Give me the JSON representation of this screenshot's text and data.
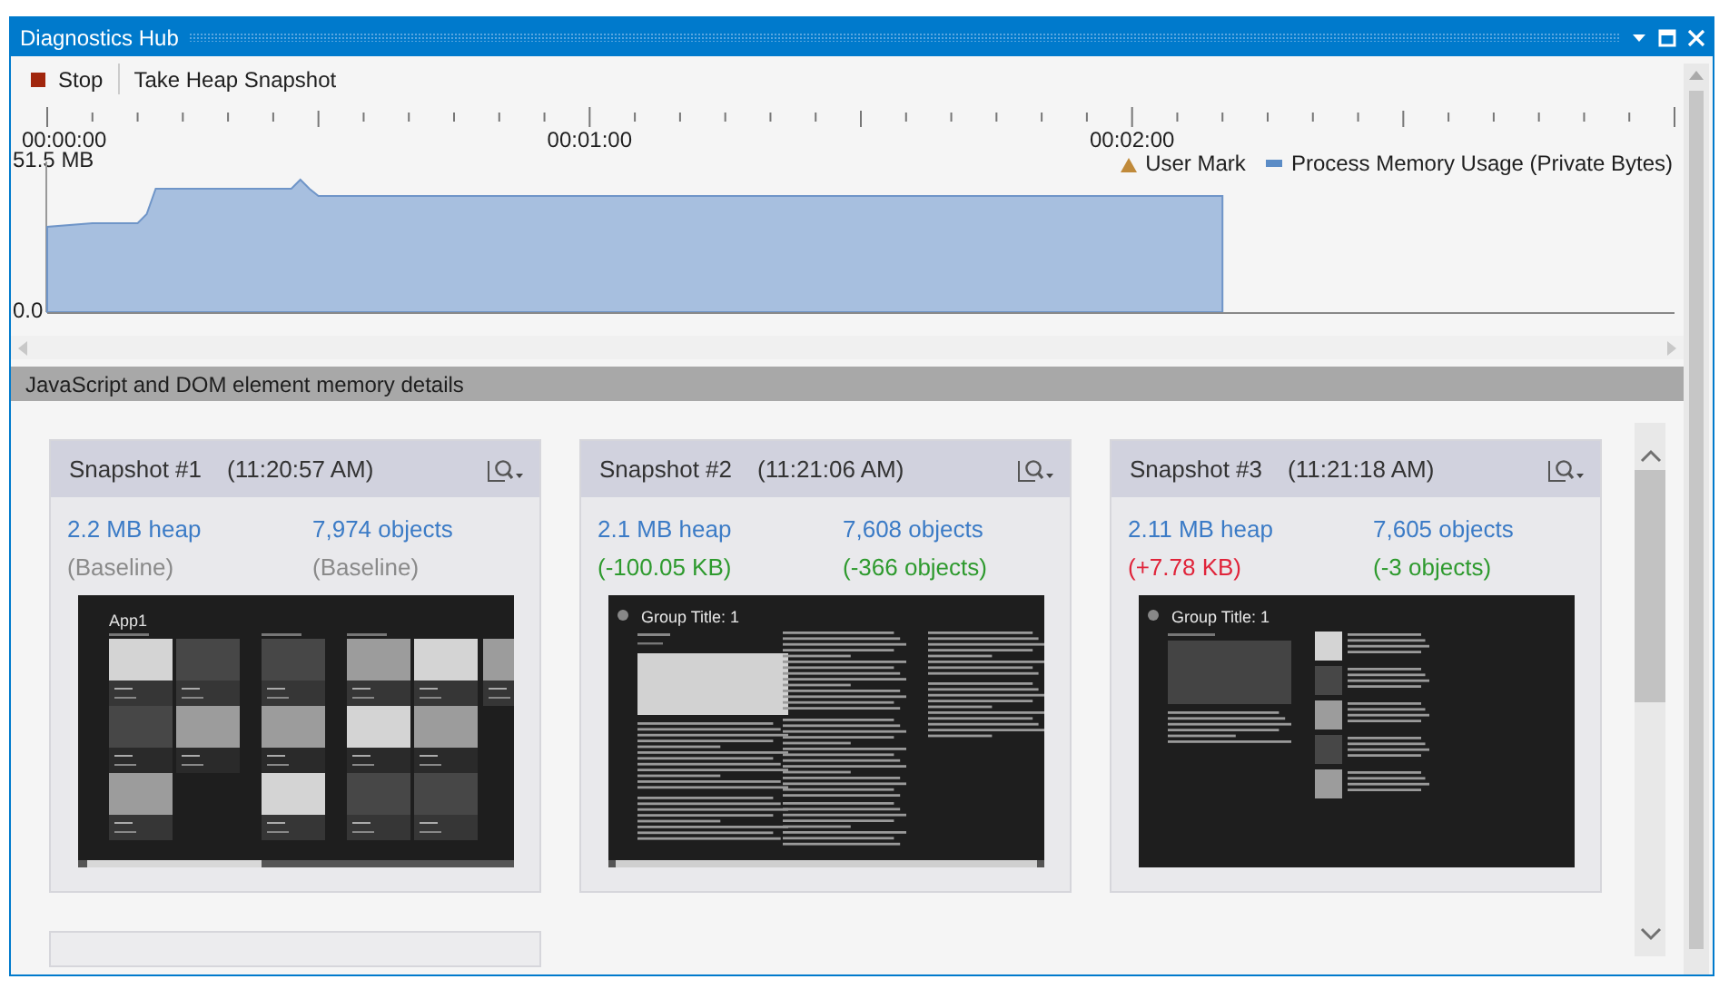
{
  "window": {
    "title": "Diagnostics Hub"
  },
  "toolbar": [
    {
      "label": "Stop",
      "kind": "stop"
    },
    {
      "label": "Take Heap Snapshot",
      "kind": "plain"
    }
  ],
  "timeline": {
    "user_mark_legend": "User Mark",
    "chart_data": {
      "type": "area",
      "x": [
        0,
        5,
        10,
        11,
        12,
        27,
        28,
        29,
        30,
        60,
        90,
        130
      ],
      "series": [
        {
          "name": "Process Memory Usage (Private Bytes)",
          "color": "#a7bfdf",
          "values": [
            29.2,
            30.4,
            30.4,
            33.5,
            42.2,
            42.2,
            45.3,
            42.2,
            39.7,
            39.7,
            39.7,
            39.7
          ]
        }
      ],
      "xlim": [
        0,
        180
      ],
      "ylim": [
        0,
        51.5
      ],
      "xticks": [
        {
          "value": 0,
          "label": "00:00:00"
        },
        {
          "value": 60,
          "label": "00:01:00"
        },
        {
          "value": 120,
          "label": "00:02:00"
        }
      ],
      "yticks": [
        {
          "value": 0,
          "label": "0.0"
        },
        {
          "value": 51.5,
          "label": "51.5 MB"
        }
      ]
    }
  },
  "section": {
    "title": "JavaScript and DOM element memory details"
  },
  "snapshots": [
    {
      "title": "Snapshot #1",
      "time": "(11:20:57 AM)",
      "heap": "2.2 MB heap",
      "objects": "7,974 objects",
      "heap_delta": {
        "text": "(Baseline)",
        "color": "#8a8a8a"
      },
      "objects_delta": {
        "text": "(Baseline)",
        "color": "#8a8a8a"
      },
      "thumbnail": {
        "kind": "tiles",
        "title": "App1"
      }
    },
    {
      "title": "Snapshot #2",
      "time": "(11:21:06 AM)",
      "heap": "2.1 MB heap",
      "objects": "7,608 objects",
      "heap_delta": {
        "text": "(-100.05 KB)",
        "color": "#2e9a2e"
      },
      "objects_delta": {
        "text": "(-366 objects)",
        "color": "#2e9a2e"
      },
      "thumbnail": {
        "kind": "article",
        "title": "Group Title: 1"
      }
    },
    {
      "title": "Snapshot #3",
      "time": "(11:21:18 AM)",
      "heap": "2.11 MB heap",
      "objects": "7,605 objects",
      "heap_delta": {
        "text": "(+7.78 KB)",
        "color": "#e0243a"
      },
      "objects_delta": {
        "text": "(-3 objects)",
        "color": "#2e9a2e"
      },
      "thumbnail": {
        "kind": "list",
        "title": "Group Title: 1"
      }
    }
  ],
  "more_cards_below": true
}
